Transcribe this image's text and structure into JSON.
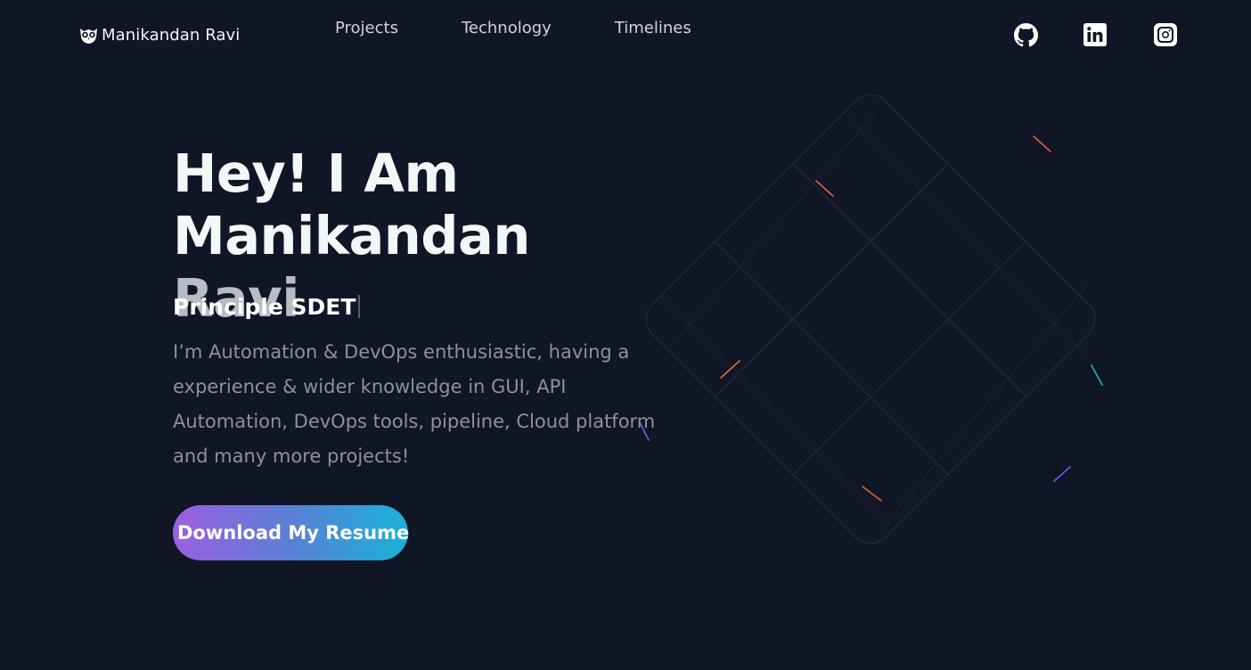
{
  "brand": {
    "logo_icon": "owl-icon",
    "name": "Manikandan Ravi"
  },
  "nav": {
    "links": [
      {
        "label": "Projects"
      },
      {
        "label": "Technology"
      },
      {
        "label": "Timelines"
      }
    ]
  },
  "socials": [
    {
      "icon": "github-icon"
    },
    {
      "icon": "linkedin-icon"
    },
    {
      "icon": "instagram-icon"
    }
  ],
  "hero": {
    "headline_line1": "Hey! I Am",
    "headline_line2_white": "Manikandan",
    "headline_line2_grey": "Ravi",
    "role": "Principle SDET",
    "description": "I’m Automation & DevOps enthusiastic, having a experience & wider knowledge in GUI, API Automation, DevOps tools, pipeline, Cloud platform and many more projects!",
    "cta_label": "Download My Resume"
  },
  "colors": {
    "background": "#101626",
    "cta_gradient_start": "#9b5fe0",
    "cta_gradient_end": "#18b2d6",
    "text_primary": "#f5f6f8",
    "text_muted": "#8c919c"
  }
}
